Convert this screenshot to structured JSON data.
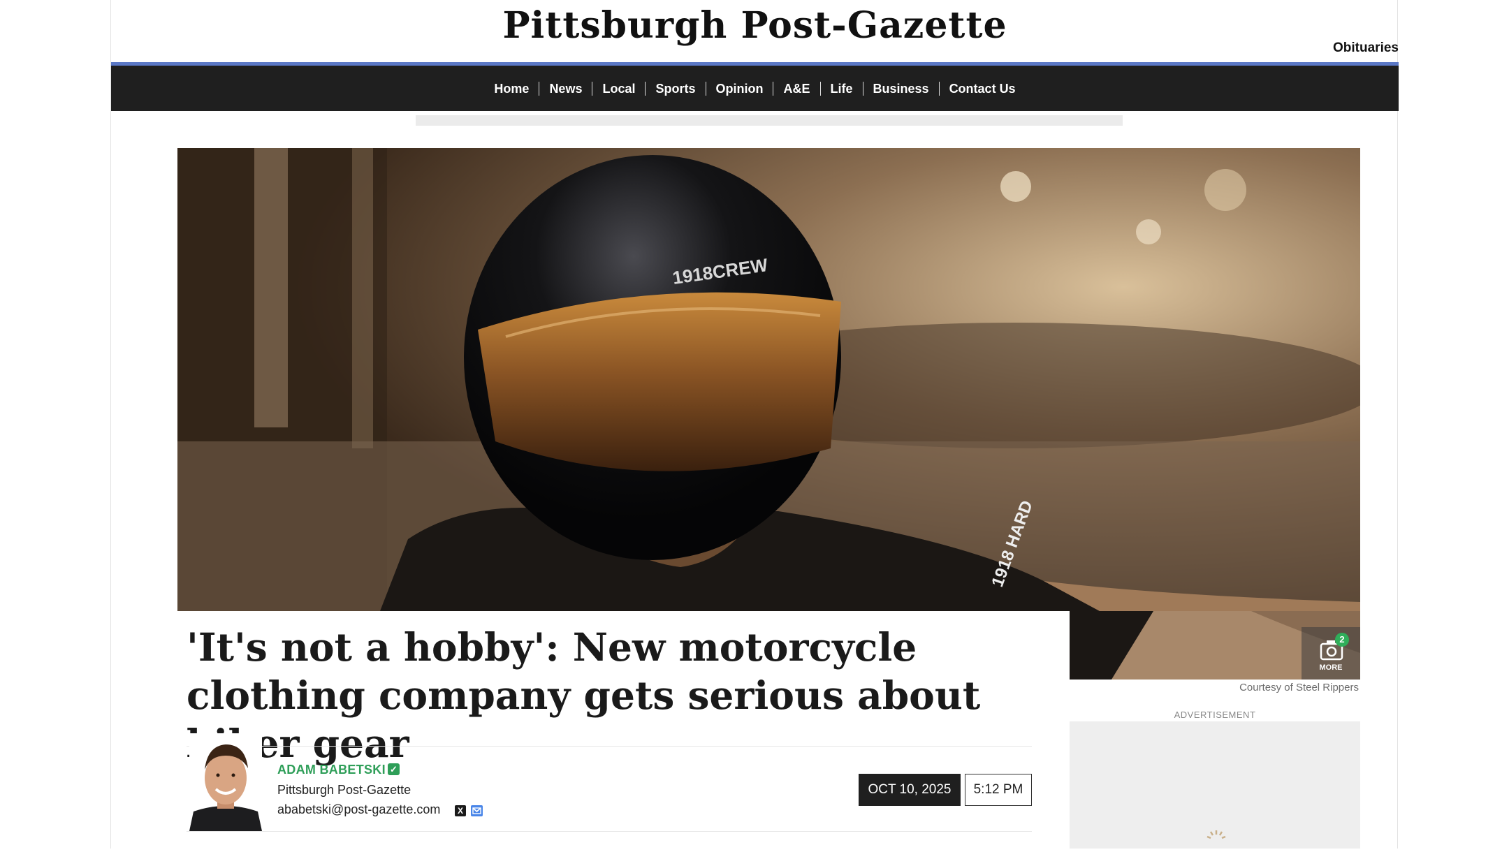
{
  "masthead": {
    "logo_text": "Pittsburgh Post-Gazette",
    "top_link": "Obituaries"
  },
  "nav": {
    "items": [
      "Home",
      "News",
      "Local",
      "Sports",
      "Opinion",
      "A&E",
      "Life",
      "Business",
      "Contact Us"
    ]
  },
  "hero": {
    "helmet_text": "1918CREW",
    "sleeve_text": "1918 HARD",
    "more_count": "2",
    "more_label": "MORE",
    "caption": "Courtesy of Steel Rippers"
  },
  "article": {
    "headline": "'It's not a hobby': New motorcycle clothing company gets serious about biker gear",
    "author_name": "ADAM BABETSKI",
    "author_org": "Pittsburgh Post-Gazette",
    "author_email": "ababetski@post-gazette.com",
    "date": "OCT 10, 2025",
    "time": "5:12 PM"
  },
  "sidebar": {
    "ad_label": "ADVERTISEMENT"
  },
  "colors": {
    "nav_bg": "#1f1f1f",
    "blue_rule": "#5b78c6",
    "author_green": "#2e9e58",
    "badge_green": "#2fae5a"
  },
  "icons": [
    "camera-icon",
    "verified-check-icon",
    "x-twitter-icon",
    "mail-icon"
  ]
}
